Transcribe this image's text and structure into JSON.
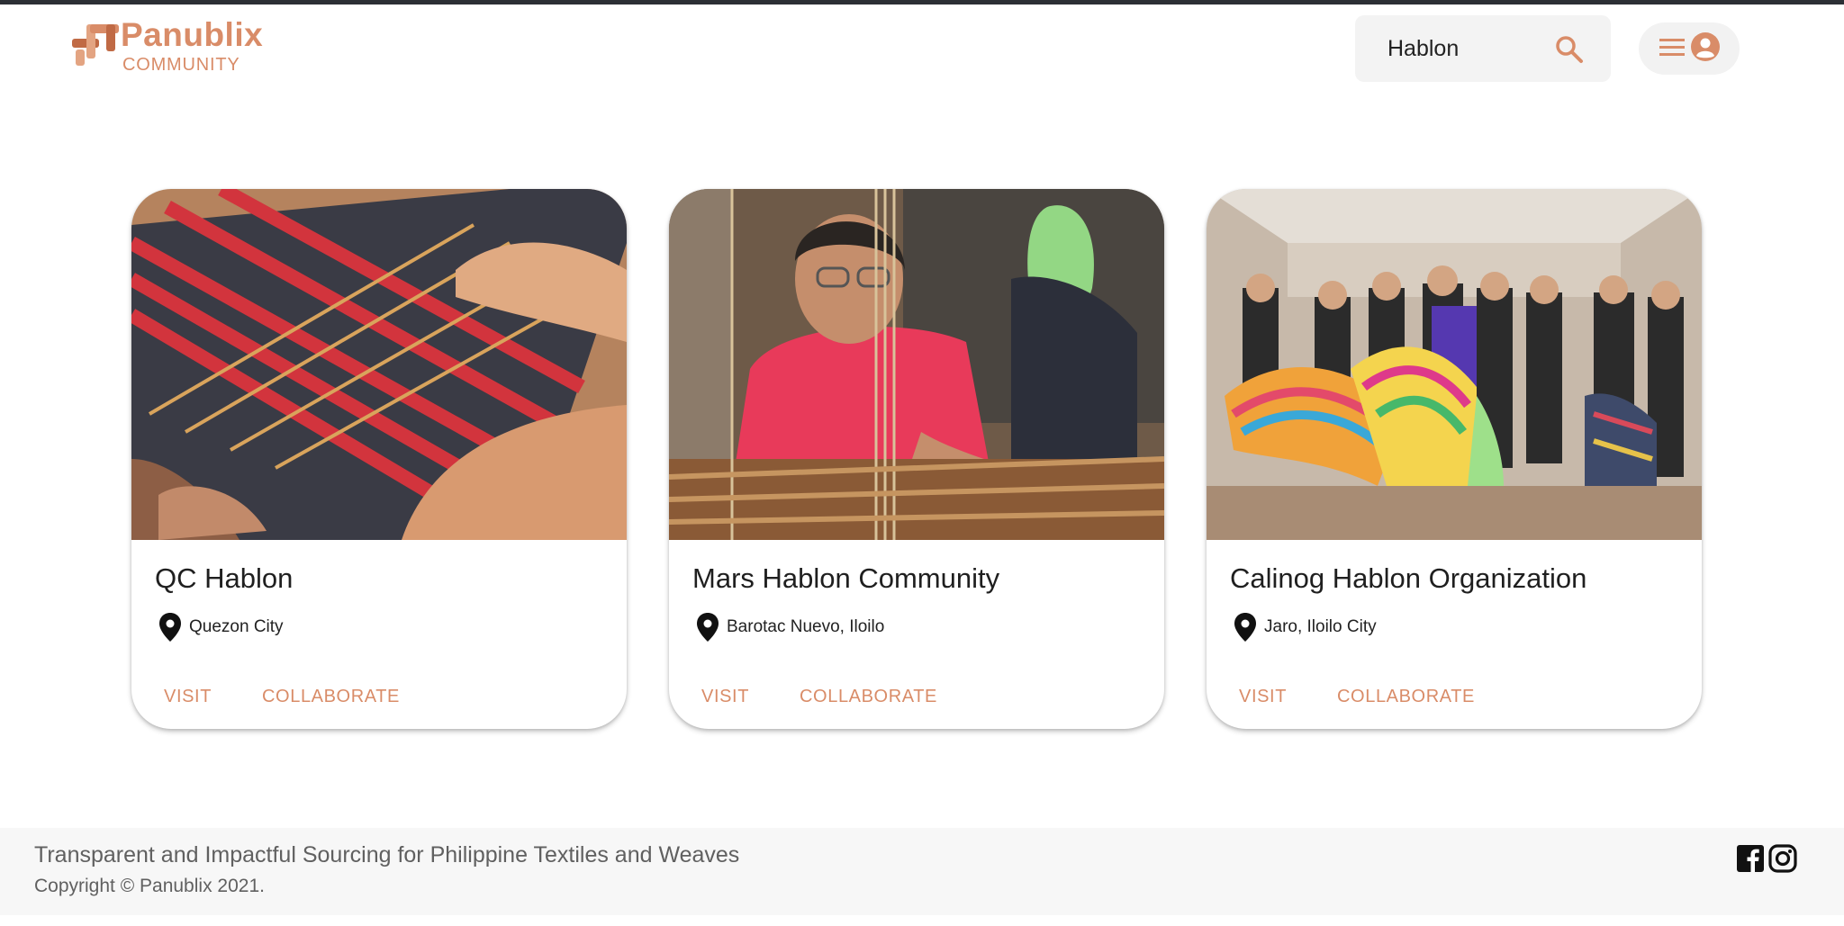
{
  "brand": {
    "name": "Panublix",
    "subtitle": "COMMUNITY",
    "accent_color": "#d98c68"
  },
  "search": {
    "value": "Hablon",
    "icon": "search-icon"
  },
  "menu": {
    "menu_icon": "hamburger-icon",
    "account_icon": "account-circle-icon"
  },
  "cards": [
    {
      "title": "QC Hablon",
      "location": "Quezon City",
      "visit_label": "VISIT",
      "collaborate_label": "COLLABORATE",
      "image": "loom-weaving-photo"
    },
    {
      "title": "Mars Hablon Community",
      "location": "Barotac Nuevo, Iloilo",
      "visit_label": "VISIT",
      "collaborate_label": "COLLABORATE",
      "image": "weaver-at-loom-photo"
    },
    {
      "title": "Calinog Hablon Organization",
      "location": "Jaro, Iloilo City",
      "visit_label": "VISIT",
      "collaborate_label": "COLLABORATE",
      "image": "group-holding-textiles-photo"
    }
  ],
  "footer": {
    "tagline": "Transparent and Impactful Sourcing for Philippine Textiles and Weaves",
    "copyright": "Copyright © Panublix 2021.",
    "social": [
      "facebook-icon",
      "instagram-icon"
    ]
  }
}
